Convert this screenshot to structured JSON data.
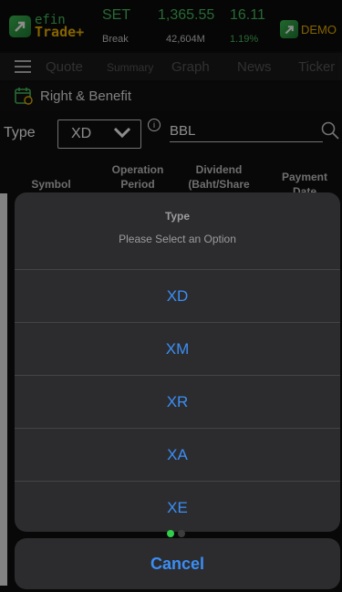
{
  "header": {
    "logo_top": "efin",
    "logo_bottom": "Trade+",
    "market_name": "SET",
    "market_status": "Break",
    "index_value": "1,365.55",
    "volume": "42,604M",
    "change": "16.11",
    "change_pct": "1.19%",
    "demo_label": "DEMO"
  },
  "menu": {
    "items": [
      "Quote",
      "Summary",
      "Graph",
      "News",
      "Ticker"
    ]
  },
  "page": {
    "title": "Right & Benefit"
  },
  "filter": {
    "type_label": "Type",
    "type_value": "XD",
    "symbol_value": "BBL"
  },
  "table": {
    "columns": [
      "Symbol",
      "Operation Period",
      "Dividend (Baht/Share",
      "Payment Date"
    ]
  },
  "sheet": {
    "title": "Type",
    "message": "Please Select an Option",
    "options": [
      "XD",
      "XM",
      "XR",
      "XA",
      "XE"
    ],
    "cancel_label": "Cancel"
  },
  "colors": {
    "accent_green": "#49c05f",
    "accent_yellow": "#f2b500",
    "action_blue": "#3b8ef5"
  }
}
